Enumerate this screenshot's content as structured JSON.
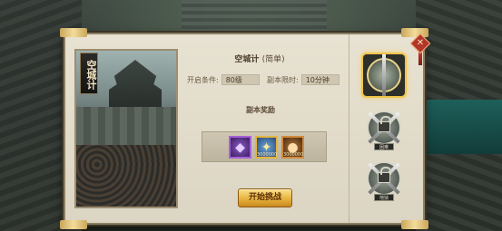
{
  "dungeon": {
    "art_title": "空城计",
    "title": "空城计",
    "difficulty": "(简单)",
    "requirement_label": "开启条件:",
    "requirement_value": "80级",
    "time_limit_label": "副本限时:",
    "time_limit_value": "10分钟",
    "rewards_title": "副本奖励",
    "start_button": "开始挑战"
  },
  "rewards": [
    {
      "icon": "purple-crystal-icon",
      "count": ""
    },
    {
      "icon": "gold-medal-icon",
      "count": "3000000"
    },
    {
      "icon": "copper-coin-icon",
      "count": "3000000"
    }
  ],
  "stages": [
    {
      "name": "stage-1",
      "locked": false,
      "tag": ""
    },
    {
      "name": "stage-2",
      "locked": true,
      "tag": "困难"
    },
    {
      "name": "stage-3",
      "locked": true,
      "tag": "地狱"
    }
  ],
  "colors": {
    "panel_bg": "#e8e2d2",
    "button_gold": "#e7b33e",
    "selected_frame": "#f0c44a"
  }
}
